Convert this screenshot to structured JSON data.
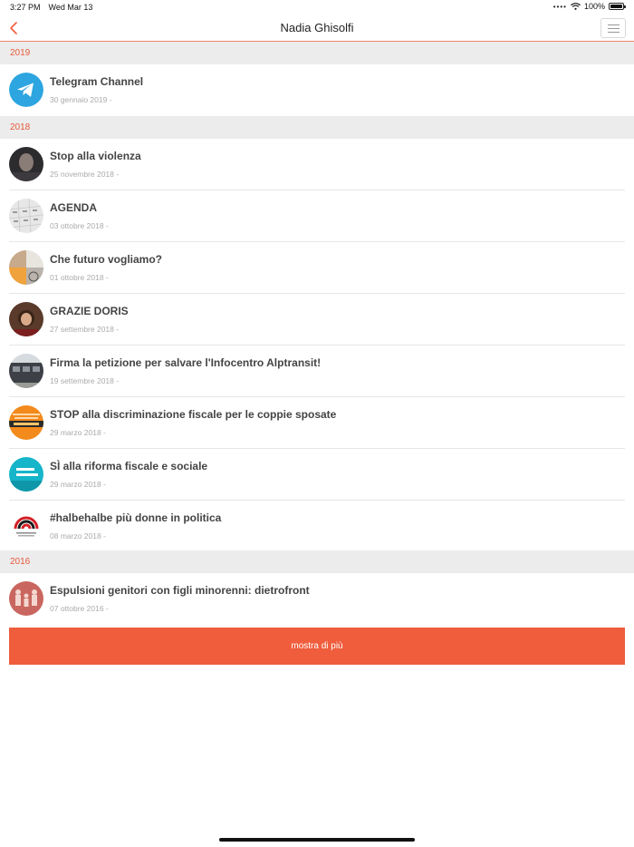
{
  "status": {
    "time": "3:27 PM",
    "date": "Wed Mar 13",
    "battery": "100%",
    "battery_level": 1.0
  },
  "nav": {
    "title": "Nadia Ghisolfi"
  },
  "colors": {
    "accent": "#ef5d3d",
    "section_bg": "#ececec"
  },
  "sections": [
    {
      "year": "2019",
      "items": [
        {
          "title": "Telegram Channel",
          "date": "30 gennaio 2019 -",
          "avatar": "telegram-logo"
        }
      ]
    },
    {
      "year": "2018",
      "items": [
        {
          "title": "Stop alla violenza",
          "date": "25 novembre 2018 -",
          "avatar": "portrait"
        },
        {
          "title": "AGENDA",
          "date": "03 ottobre 2018 -",
          "avatar": "calendar"
        },
        {
          "title": "Che futuro vogliamo?",
          "date": "01 ottobre 2018 -",
          "avatar": "collage"
        },
        {
          "title": "GRAZIE DORIS",
          "date": "27 settembre 2018 -",
          "avatar": "portrait"
        },
        {
          "title": "Firma la petizione per salvare l'Infocentro Alptransit!",
          "date": "19 settembre 2018 -",
          "avatar": "building"
        },
        {
          "title": "STOP alla discriminazione fiscale per le coppie sposate",
          "date": "29 marzo 2018 -",
          "avatar": "orange-poster"
        },
        {
          "title": "SÌ alla riforma fiscale e sociale",
          "date": "29 marzo 2018 -",
          "avatar": "teal-poster"
        },
        {
          "title": "#halbehalbe più donne in politica",
          "date": "08 marzo 2018 -",
          "avatar": "red-logo"
        }
      ]
    },
    {
      "year": "2016",
      "items": [
        {
          "title": "Espulsioni genitori con figli minorenni: dietrofront",
          "date": "07 ottobre 2016 -",
          "avatar": "family"
        }
      ]
    }
  ],
  "more_button": "mostra di più"
}
